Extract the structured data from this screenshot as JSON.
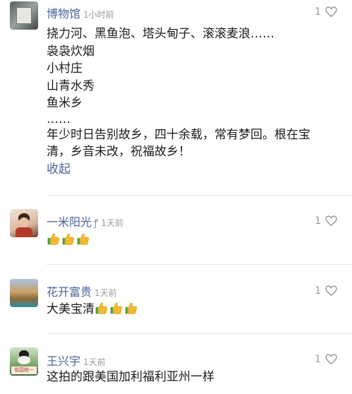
{
  "comments": [
    {
      "name": "博物馆",
      "time": "1小时前",
      "likes": "1",
      "lines": [
        "挠力河、黑鱼泡、塔头甸子、滚滚麦浪……",
        "袅袅炊烟",
        "小村庄",
        "山青水秀",
        "鱼米乡",
        "……",
        "年少时日告别故乡，四十余载，常有梦回。根在宝",
        "清，乡音未改，祝福故乡！"
      ],
      "collapse_label": "收起"
    },
    {
      "name": "一米阳光",
      "time": "1天前",
      "likes": "1",
      "thumbs_count": 3
    },
    {
      "name": "花开富贵",
      "time": "1天前",
      "likes": "1",
      "text": "大美宝清",
      "thumbs_count": 3
    },
    {
      "name": "王兴宇",
      "time": "1天前",
      "likes": "1",
      "text": "这拍的跟美国加利福利亚州一样",
      "avatar_text": "祖国统一"
    }
  ],
  "colors": {
    "name": "#49629a",
    "meta": "#9a9a9a",
    "thumb": "#f5b82e"
  }
}
